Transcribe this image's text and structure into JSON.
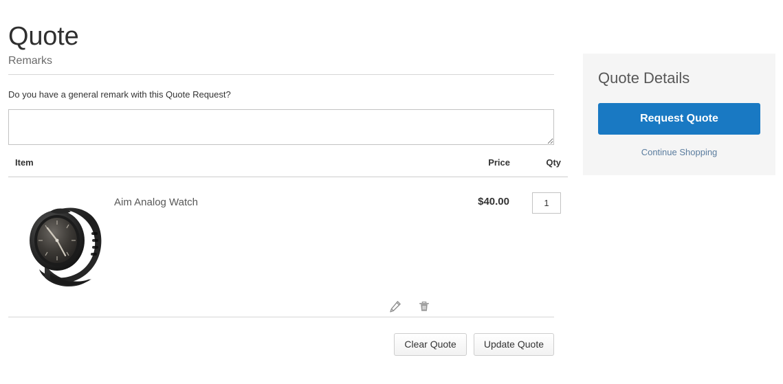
{
  "page": {
    "title": "Quote"
  },
  "remarks": {
    "legend": "Remarks",
    "question": "Do you have a general remark with this Quote Request?",
    "value": "",
    "placeholder": ""
  },
  "items_table": {
    "columns": {
      "item": "Item",
      "price": "Price",
      "qty": "Qty"
    },
    "rows": [
      {
        "name": "Aim Analog Watch",
        "price": "$40.00",
        "qty": "1",
        "image_alt": "Aim Analog Watch",
        "edit_icon": "pencil-icon",
        "delete_icon": "trash-icon"
      }
    ]
  },
  "main_actions": {
    "clear_label": "Clear Quote",
    "update_label": "Update Quote"
  },
  "sidebar": {
    "title": "Quote Details",
    "request_quote_label": "Request Quote",
    "continue_shopping_label": "Continue Shopping"
  },
  "colors": {
    "primary": "#1979c3",
    "sidebar_bg": "#f5f5f5",
    "link": "#5a7c9e",
    "text": "#333333",
    "muted_text": "#6a6a6a",
    "rule": "#d6d6d6"
  }
}
